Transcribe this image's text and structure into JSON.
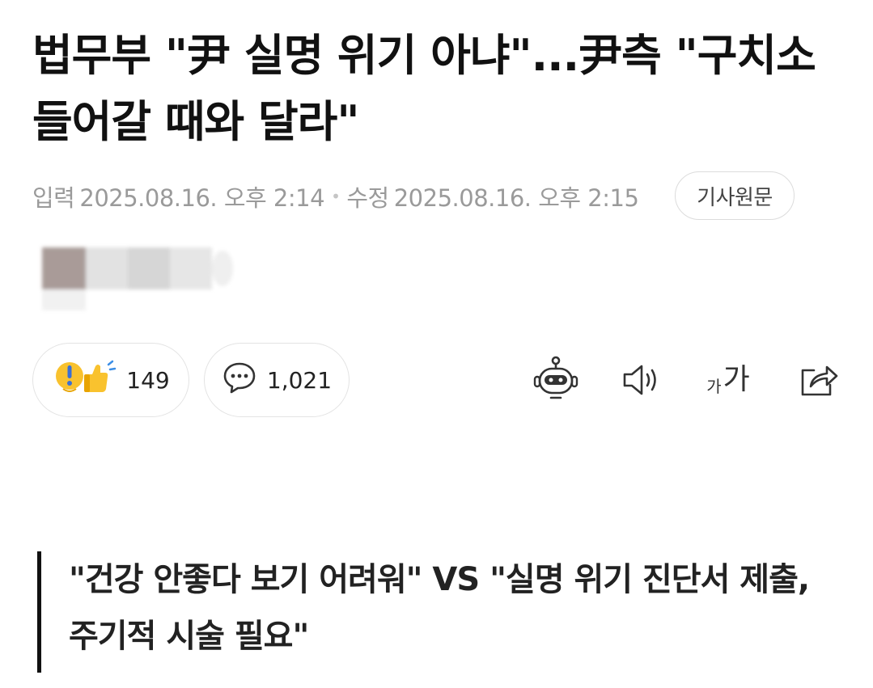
{
  "article": {
    "headline": "법무부 \"尹 실명 위기 아냐\"...尹측 \"구치소 들어갈 때와 달라\"",
    "meta": {
      "published_label": "입력",
      "published_time": "2025.08.16. 오후 2:14",
      "separator": "•",
      "modified_label": "수정",
      "modified_time": "2025.08.16. 오후 2:15"
    },
    "source_button": "기사원문",
    "subheading": "\"건강 안좋다 보기 어려워\" VS \"실명 위기 진단서 제출, 주기적 시술 필요\""
  },
  "engagement": {
    "reaction_count": "149",
    "comment_count": "1,021"
  },
  "toolbar": {
    "font_size_small": "가",
    "font_size_large": "가"
  },
  "icons": {
    "reaction": "reaction-emoji-icon",
    "comment": "comment-bubble-icon",
    "summary_bot": "robot-icon",
    "audio": "speaker-icon",
    "font_size": "font-size-icon",
    "share": "share-icon"
  },
  "colors": {
    "text_primary": "#111111",
    "text_meta": "#9a9a9a",
    "border_light": "#e3e3e3",
    "reaction_yellow": "#f9c22e",
    "reaction_blue": "#3b8ee6"
  }
}
